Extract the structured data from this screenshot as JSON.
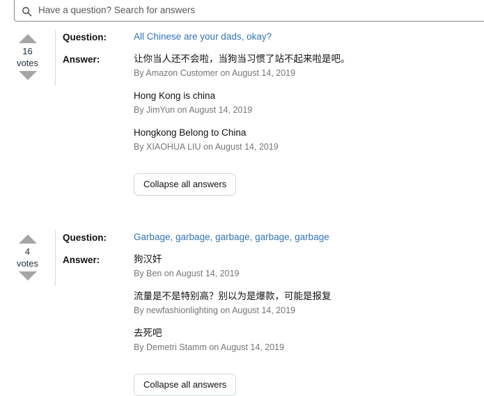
{
  "search": {
    "placeholder": "Have a question? Search for answers",
    "value": "",
    "icon": "search-icon"
  },
  "labels": {
    "question": "Question:",
    "answer": "Answer:",
    "votes": "votes",
    "collapse_button": "Collapse all answers",
    "upvote_icon": "up-arrow-icon",
    "downvote_icon": "down-arrow-icon"
  },
  "colors": {
    "link": "#3474b4",
    "text": "#111111",
    "muted": "#767676",
    "border": "#d5d9d9",
    "arrow": "#a5a5a5"
  },
  "blocks": [
    {
      "votes": "16",
      "question": "All Chinese are your dads, okay?",
      "answers": [
        {
          "text": "让你当人还不会啦，当狗当习惯了站不起来啦是吧。",
          "byline": "By Amazon Customer on August 14, 2019"
        },
        {
          "text": "Hong Kong is china",
          "byline": "By JimYun on August 14, 2019"
        },
        {
          "text": "Hongkong Belong to China",
          "byline": "By XIAOHUA LIU on August 14, 2019"
        }
      ]
    },
    {
      "votes": "4",
      "question": "Garbage, garbage, garbage, garbage, garbage",
      "answers": [
        {
          "text": "狗汉奸",
          "byline": "By Ben on August 14, 2019"
        },
        {
          "text": "流量是不是特别高？别以为是爆款，可能是报复",
          "byline": "By newfashionlighting on August 14, 2019"
        },
        {
          "text": "去死吧",
          "byline": "By Demetri Stamm on August 14, 2019"
        }
      ]
    }
  ]
}
